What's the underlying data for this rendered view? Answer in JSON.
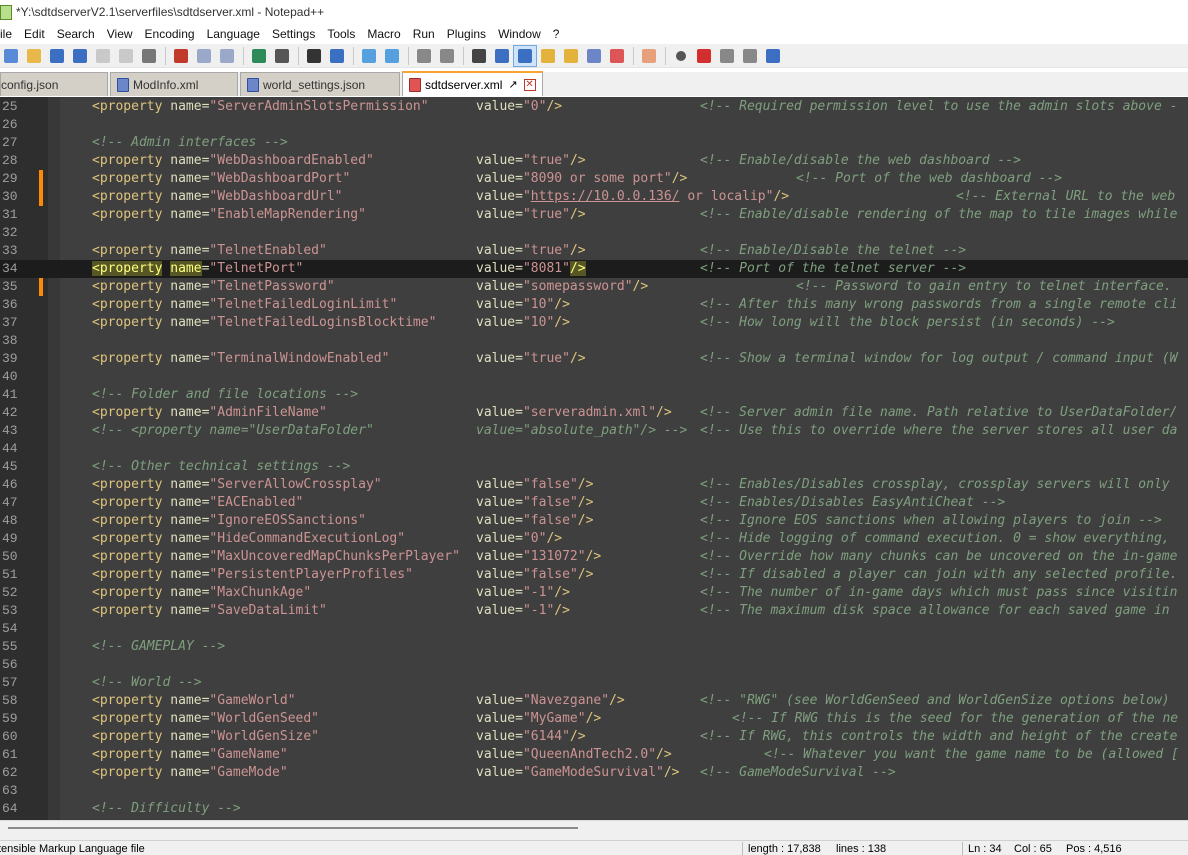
{
  "window": {
    "title": "*Y:\\sdtdserverV2.1\\serverfiles\\sdtdserver.xml - Notepad++"
  },
  "menu": [
    "ile",
    "Edit",
    "Search",
    "View",
    "Encoding",
    "Language",
    "Settings",
    "Tools",
    "Macro",
    "Run",
    "Plugins",
    "Window",
    "?"
  ],
  "toolbar": {
    "icons": [
      "new-file-icon",
      "open-file-icon",
      "save-icon",
      "save-all-icon",
      "close-icon",
      "close-all-icon",
      "print-icon",
      "cut-icon",
      "copy-icon",
      "paste-icon",
      "undo-icon",
      "redo-icon",
      "find-icon",
      "replace-icon",
      "zoom-in-icon",
      "zoom-out-icon",
      "sync-vertical-icon",
      "sync-horizontal-icon",
      "word-wrap-icon",
      "show-all-chars-icon",
      "indent-guide-icon",
      "language-icon",
      "function-list-icon",
      "document-map-icon",
      "folder-workspace-icon",
      "monitoring-icon",
      "record-macro-icon",
      "stop-macro-icon",
      "play-macro-icon",
      "run-macro-multiple-icon",
      "save-macro-icon"
    ]
  },
  "tabs": [
    {
      "label": "config.json",
      "active": false
    },
    {
      "label": "ModInfo.xml",
      "active": false
    },
    {
      "label": "world_settings.json",
      "active": false
    },
    {
      "label": "sdtdserver.xml",
      "active": true
    }
  ],
  "colors": {
    "editor_bg": "#3f3f3f",
    "tag": "#dfc47d",
    "string": "#cc9393",
    "comment": "#7f9f7f",
    "change_mark": "#ff8c00",
    "active_tab_accent": "#f7a433"
  },
  "lines": [
    {
      "n": "25",
      "name": "ServerAdminSlotsPermission",
      "value": "0",
      "comment": "<!-- Required permission level to use the admin slots above -"
    },
    {
      "n": "26"
    },
    {
      "n": "27",
      "section": "<!-- Admin interfaces -->"
    },
    {
      "n": "28",
      "name": "WebDashboardEnabled",
      "value": "true",
      "comment": "<!-- Enable/disable the web dashboard -->"
    },
    {
      "n": "29",
      "name": "WebDashboardPort",
      "value": "8090 or some port",
      "comment": "<!-- Port of the web dashboard -->",
      "changed": true
    },
    {
      "n": "30",
      "name": "WebDashboardUrl",
      "value_link": "https://10.0.0.136/",
      "value_tail": " or localip",
      "comment": "<!-- External URL to the web",
      "changed": true
    },
    {
      "n": "31",
      "name": "EnableMapRendering",
      "value": "true",
      "comment": "<!-- Enable/disable rendering of the map to tile images while"
    },
    {
      "n": "32"
    },
    {
      "n": "33",
      "name": "TelnetEnabled",
      "value": "true",
      "comment": "<!-- Enable/Disable the telnet -->"
    },
    {
      "n": "34",
      "name": "TelnetPort",
      "value": "8081",
      "comment": "<!-- Port of the telnet server -->",
      "current": true
    },
    {
      "n": "35",
      "name": "TelnetPassword",
      "value": "somepassword",
      "comment": "<!-- Password to gain entry to telnet interface.",
      "changed": true
    },
    {
      "n": "36",
      "name": "TelnetFailedLoginLimit",
      "value": "10",
      "comment": "<!-- After this many wrong passwords from a single remote cli"
    },
    {
      "n": "37",
      "name": "TelnetFailedLoginsBlocktime",
      "value": "10",
      "comment": "<!-- How long will the block persist (in seconds) -->"
    },
    {
      "n": "38"
    },
    {
      "n": "39",
      "name": "TerminalWindowEnabled",
      "value": "true",
      "comment": "<!-- Show a terminal window for log output / command input (W"
    },
    {
      "n": "40"
    },
    {
      "n": "41",
      "section": "<!-- Folder and file locations -->"
    },
    {
      "n": "42",
      "name": "AdminFileName",
      "value": "serveradmin.xml",
      "comment": "<!-- Server admin file name. Path relative to UserDataFolder/"
    },
    {
      "n": "43",
      "commented_out": true,
      "name": "UserDataFolder",
      "value": "absolute_path",
      "comment": "<!-- Use this to override where the server stores all user da"
    },
    {
      "n": "44"
    },
    {
      "n": "45",
      "section": "<!-- Other technical settings -->"
    },
    {
      "n": "46",
      "name": "ServerAllowCrossplay",
      "value": "false",
      "comment": "<!-- Enables/Disables crossplay, crossplay servers will only"
    },
    {
      "n": "47",
      "name": "EACEnabled",
      "value": "false",
      "comment": "<!-- Enables/Disables EasyAntiCheat -->"
    },
    {
      "n": "48",
      "name": "IgnoreEOSSanctions",
      "value": "false",
      "comment": "<!-- Ignore EOS sanctions when allowing players to join -->"
    },
    {
      "n": "49",
      "name": "HideCommandExecutionLog",
      "value": "0",
      "comment": "<!-- Hide logging of command execution. 0 = show everything,"
    },
    {
      "n": "50",
      "name": "MaxUncoveredMapChunksPerPlayer",
      "value": "131072",
      "comment": "<!-- Override how many chunks can be uncovered on the in-game"
    },
    {
      "n": "51",
      "name": "PersistentPlayerProfiles",
      "value": "false",
      "comment": "<!-- If disabled a player can join with any selected profile."
    },
    {
      "n": "52",
      "name": "MaxChunkAge",
      "value": "-1",
      "comment": "<!-- The number of in-game days which must pass since visitin"
    },
    {
      "n": "53",
      "name": "SaveDataLimit",
      "value": "-1",
      "comment": "<!-- The maximum disk space allowance for each saved game in"
    },
    {
      "n": "54"
    },
    {
      "n": "55",
      "section": "<!-- GAMEPLAY -->"
    },
    {
      "n": "56"
    },
    {
      "n": "57",
      "section": "<!-- World -->"
    },
    {
      "n": "58",
      "name": "GameWorld",
      "value": "Navezgane",
      "comment": "<!-- \"RWG\" (see WorldGenSeed and WorldGenSize options below)"
    },
    {
      "n": "59",
      "name": "WorldGenSeed",
      "value": "MyGame",
      "comment": "<!-- If RWG this is the seed for the generation of the ne"
    },
    {
      "n": "60",
      "name": "WorldGenSize",
      "value": "6144",
      "comment": "<!-- If RWG, this controls the width and height of the create"
    },
    {
      "n": "61",
      "name": "GameName",
      "value": "QueenAndTech2.0",
      "comment": "<!-- Whatever you want the game name to be (allowed ["
    },
    {
      "n": "62",
      "name": "GameMode",
      "value": "GameModeSurvival",
      "comment": "<!-- GameModeSurvival -->"
    },
    {
      "n": "63"
    },
    {
      "n": "64",
      "section": "<!-- Difficulty -->"
    }
  ],
  "status": {
    "filetype": "tensible Markup Language file",
    "length": "length : 17,838",
    "lines": "lines : 138",
    "ln": "Ln : 34",
    "col": "Col : 65",
    "pos": "Pos : 4,516"
  }
}
